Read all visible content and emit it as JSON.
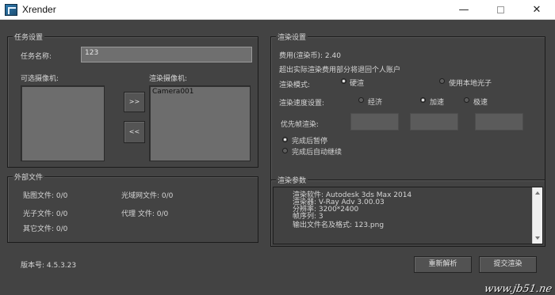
{
  "window": {
    "title": "Xrender",
    "minimize": "—",
    "close": "✕"
  },
  "task": {
    "title": "任务设置",
    "name_label": "任务名称:",
    "name_value": "123",
    "available_cameras_label": "可选摄像机:",
    "render_cameras_label": "渲染摄像机:",
    "render_cameras": [
      "Camera001"
    ],
    "add_button": ">>",
    "remove_button": "<<"
  },
  "render_settings": {
    "title": "渲染设置",
    "cost": "费用(渲染币): 2.40",
    "notice": "超出实际渲染费用部分将退回个人账户",
    "mode_label": "渲染模式:",
    "mode_options": [
      "硬渲",
      "使用本地光子"
    ],
    "mode_selected": "硬渲",
    "speed_label": "渲染速度设置:",
    "speed_options": [
      "经济",
      "加速",
      "极速"
    ],
    "speed_selected": "加速",
    "priority_label": "优先帧渲染:",
    "after_options": [
      "完成后暂停",
      "完成后自动继续"
    ]
  },
  "external_files": {
    "title": "外部文件",
    "texture": "贴图文件: 0/0",
    "ies": "光域网文件: 0/0",
    "photon": "光子文件: 0/0",
    "proxy": "代理  文件: 0/0",
    "other": "其它文件: 0/0"
  },
  "render_params": {
    "title": "渲染参数",
    "lines": [
      "渲染软件: Autodesk 3ds Max 2014",
      "渲染器: V-Ray Adv 3.00.03",
      "分辨率: 3200*2400",
      "帧序列: 3",
      "输出文件名及格式: 123.png"
    ]
  },
  "footer": {
    "version": "版本号: 4.5.3.23",
    "reparse_button": "重新解析",
    "submit_button": "提交渲染",
    "watermark": "www.jb51.ne"
  },
  "colors": {
    "background": "#434343",
    "panel_border": "#1b1b1b",
    "text": "#d6d6d6"
  }
}
